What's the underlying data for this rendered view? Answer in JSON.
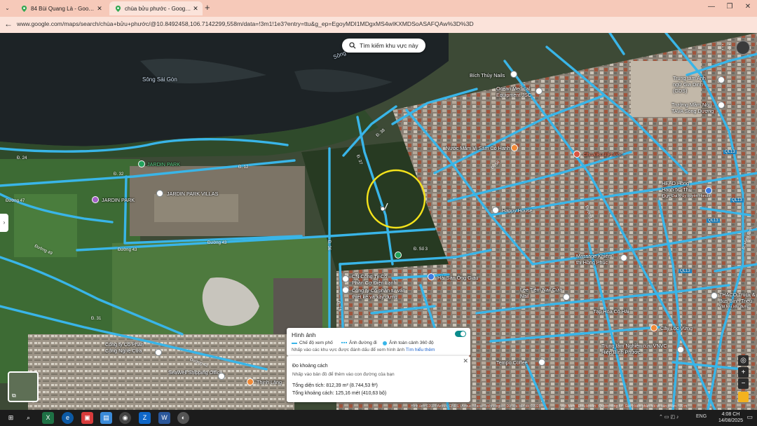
{
  "browser": {
    "tabs": [
      {
        "title": "84 Bùi Quang Là - Google Maps",
        "active": false
      },
      {
        "title": "chùa bửu phước - Google Maps",
        "active": true
      }
    ],
    "url": "www.google.com/maps/search/chùa+bửu+phước/@10.8492458,106.7142299,558m/data=!3m1!1e3?entry=ttu&g_ep=EgoyMDI1MDgxMS4wIKXMDSoASAFQAw%3D%3D",
    "new_tab_label": "+",
    "window_controls": [
      "—",
      "❐",
      "✕"
    ]
  },
  "map": {
    "search_area_label": "Tìm kiếm khu vực này",
    "water_labels": [
      "Sông Sài Gòn",
      "Sông"
    ],
    "places": [
      {
        "name": "JARDIN PARK",
        "color": "#22a15b"
      },
      {
        "name": "JARDIN PARK VILLAS"
      },
      {
        "name": "JARDIN PARK"
      },
      {
        "name": "Bích Thủy Nails"
      },
      {
        "name": "Ocean Medical Equipment JSC"
      },
      {
        "name": "Nước Mắm Vị Sâm Cô Hạnh"
      },
      {
        "name": "Chùa Bửu Phước"
      },
      {
        "name": "Trung tâm Anh ngữ Gia Dinh (GDS)"
      },
      {
        "name": "Trường Mầm Non TAVA Song Dương"
      },
      {
        "name": "HEAD Hồng Hạnh 5C Thủ Đức"
      },
      {
        "name": "Đại lý ủy quyền Honda"
      },
      {
        "name": "Happy House"
      },
      {
        "name": "CN Công Ty Cổ Phần Cơ Điện Lạnh"
      },
      {
        "name": "Công ty Cổ phần tư vấn thiết kế và xây dựng"
      },
      {
        "name": "Hải Sản Ông Giàu"
      },
      {
        "name": "Massage Khiếm thị Hồng Phúc"
      },
      {
        "name": "Lee Tiệm Nail Cửa Nail"
      },
      {
        "name": "Công ty Cổ Phần Công Nghệ Cửa"
      },
      {
        "name": "SeaWell Shipping Office"
      },
      {
        "name": "Thịnh Lăng"
      },
      {
        "name": "Tempo Coffee"
      },
      {
        "name": "Tạp Hóa Cô Hải"
      },
      {
        "name": "Trung tâm Nghiên cứu VNVC Hiệp Bình Phước"
      },
      {
        "name": "Cây Lộc Vừng"
      },
      {
        "name": "THACO Truck & Bus Bình Triệu"
      },
      {
        "name": "Vật liệu xây dựng"
      }
    ],
    "streets": [
      "Đ. 24",
      "Đ. 32",
      "Đ. 12",
      "Đường 47",
      "Đường 43",
      "Đường 43",
      "Đường 49",
      "Đ. 31",
      "Đường 41",
      "Đ. 36",
      "Đ. 37",
      "Đ. 38",
      "Đ. Số 3",
      "Đ. 56",
      "Đường 6",
      "Đ. 26",
      "QL13",
      "QL13",
      "QL13",
      "QL13",
      "Đ. Hiệp Bình"
    ],
    "imagery_panel": {
      "title": "Hình ảnh",
      "legend": [
        "Chế độ xem phố",
        "Ảnh đường đi",
        "Ảnh toàn cảnh 360 độ"
      ],
      "hint": "Nhấp vào các khu vực được đánh dấu để xem hình ảnh",
      "link": "Tìm hiểu thêm",
      "toggle_on": true
    },
    "distance_panel": {
      "title": "Đo khoảng cách",
      "subtitle": "Nhấp vào bản đồ để thêm vào con đường của bạn",
      "area": "Tổng diện tích: 812,39 m² (8.744,53 ft²)",
      "distance": "Tổng khoảng cách: 125,16 mét (410,63 bộ)",
      "close": "✕"
    },
    "layers_label": "Lớp",
    "zoom_in": "+",
    "zoom_out": "−",
    "attribution": "Hình ảnh ©2025 Airbus, CNES / Airbus, Maxar Technologies, Dữ liệu bản đồ ©2025",
    "footer_links": [
      "Việt Nam",
      "Điều khoản",
      "Quyền riêng tư",
      "Gửi ý kiến phản hồi về sản phẩm",
      "20 m"
    ]
  },
  "taskbar": {
    "language": "ENG",
    "time": "4:08 CH",
    "date": "14/08/2025"
  }
}
